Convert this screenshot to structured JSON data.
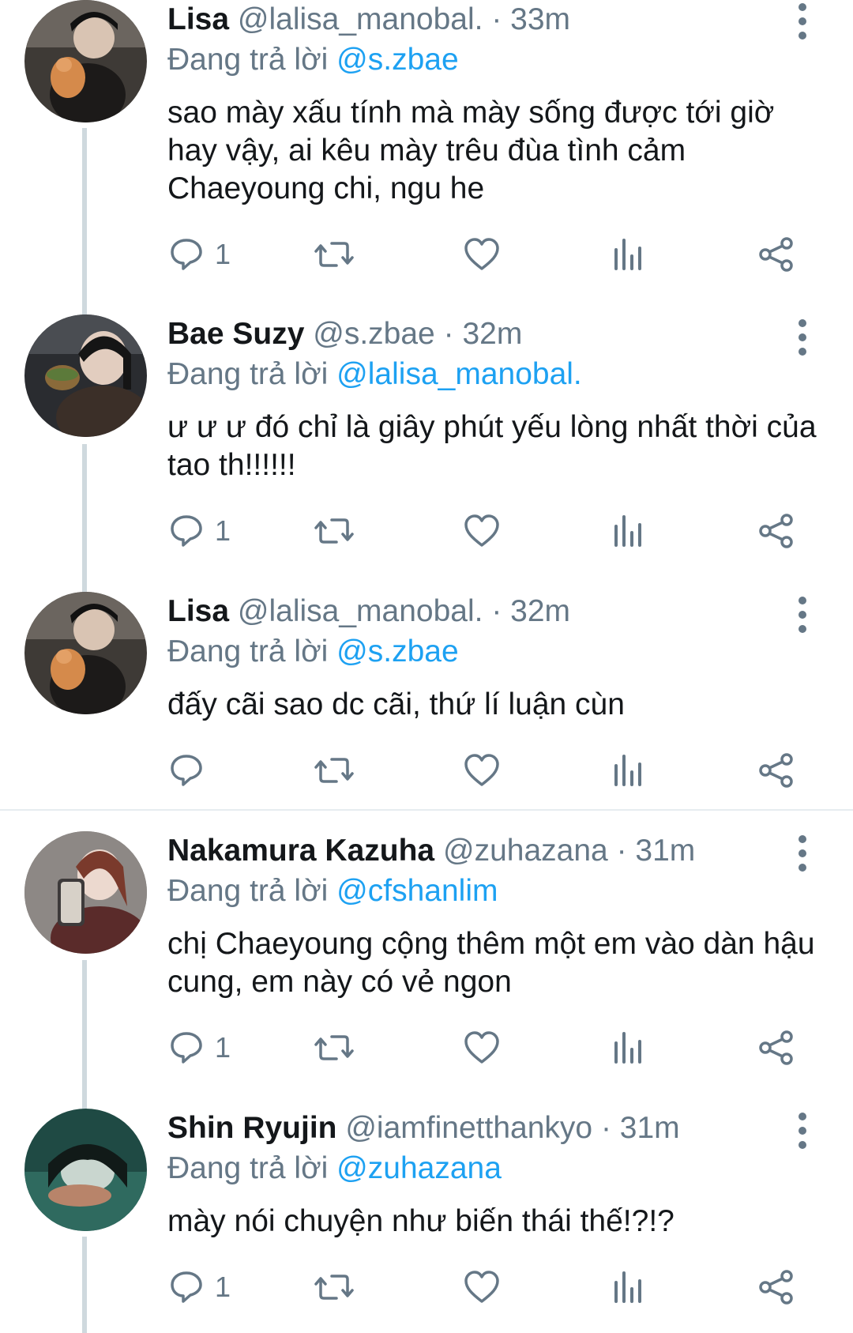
{
  "tweets": [
    {
      "name": "Lisa",
      "handle": "@lalisa_manobal.",
      "separator": "·",
      "time": "33m",
      "replying_label": "Đang trả lời",
      "replying_to": "@s.zbae",
      "text": "sao mày xấu tính mà mày sống được tới giờ hay vậy, ai kêu mày trêu đùa tình cảm Chaeyoung chi, ngu he",
      "reply_count": "1"
    },
    {
      "name": "Bae Suzy",
      "handle": "@s.zbae",
      "separator": "·",
      "time": "32m",
      "replying_label": "Đang trả lời",
      "replying_to": "@lalisa_manobal.",
      "text": "ư ư ư đó chỉ là giây phút yếu lòng nhất thời của tao th!!!!!!",
      "reply_count": "1"
    },
    {
      "name": "Lisa",
      "handle": "@lalisa_manobal.",
      "separator": "·",
      "time": "32m",
      "replying_label": "Đang trả lời",
      "replying_to": "@s.zbae",
      "text": "đấy cãi sao dc cãi, thứ lí luận cùn",
      "reply_count": ""
    },
    {
      "name": "Nakamura Kazuha",
      "handle": "@zuhazana",
      "separator": "·",
      "time": "31m",
      "replying_label": "Đang trả lời",
      "replying_to": "@cfshanlim",
      "text": "chị Chaeyoung cộng thêm một em vào dàn hậu cung, em này có vẻ ngon",
      "reply_count": "1"
    },
    {
      "name": "Shin Ryujin",
      "handle": "@iamfinetthankyo",
      "separator": "·",
      "time": "31m",
      "replying_label": "Đang trả lời",
      "replying_to": "@zuhazana",
      "text": "mày nói chuyện như biến thái thế!?!?",
      "reply_count": "1"
    }
  ],
  "icons": [
    "reply-icon",
    "retweet-icon",
    "like-icon",
    "analytics-icon",
    "share-icon",
    "more-options-icon"
  ],
  "colors": {
    "text": "#14171a",
    "secondary": "#657786",
    "link": "#1da1f2",
    "thread_line": "#cfd9de",
    "divider": "#e6ecf0"
  }
}
